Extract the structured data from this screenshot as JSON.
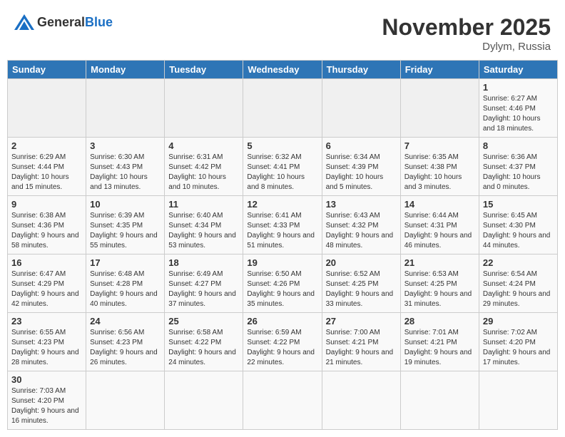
{
  "header": {
    "logo_general": "General",
    "logo_blue": "Blue",
    "month_year": "November 2025",
    "location": "Dylym, Russia"
  },
  "weekdays": [
    "Sunday",
    "Monday",
    "Tuesday",
    "Wednesday",
    "Thursday",
    "Friday",
    "Saturday"
  ],
  "weeks": [
    [
      {
        "day": "",
        "info": ""
      },
      {
        "day": "",
        "info": ""
      },
      {
        "day": "",
        "info": ""
      },
      {
        "day": "",
        "info": ""
      },
      {
        "day": "",
        "info": ""
      },
      {
        "day": "",
        "info": ""
      },
      {
        "day": "1",
        "info": "Sunrise: 6:27 AM\nSunset: 4:46 PM\nDaylight: 10 hours and 18 minutes."
      }
    ],
    [
      {
        "day": "2",
        "info": "Sunrise: 6:29 AM\nSunset: 4:44 PM\nDaylight: 10 hours and 15 minutes."
      },
      {
        "day": "3",
        "info": "Sunrise: 6:30 AM\nSunset: 4:43 PM\nDaylight: 10 hours and 13 minutes."
      },
      {
        "day": "4",
        "info": "Sunrise: 6:31 AM\nSunset: 4:42 PM\nDaylight: 10 hours and 10 minutes."
      },
      {
        "day": "5",
        "info": "Sunrise: 6:32 AM\nSunset: 4:41 PM\nDaylight: 10 hours and 8 minutes."
      },
      {
        "day": "6",
        "info": "Sunrise: 6:34 AM\nSunset: 4:39 PM\nDaylight: 10 hours and 5 minutes."
      },
      {
        "day": "7",
        "info": "Sunrise: 6:35 AM\nSunset: 4:38 PM\nDaylight: 10 hours and 3 minutes."
      },
      {
        "day": "8",
        "info": "Sunrise: 6:36 AM\nSunset: 4:37 PM\nDaylight: 10 hours and 0 minutes."
      }
    ],
    [
      {
        "day": "9",
        "info": "Sunrise: 6:38 AM\nSunset: 4:36 PM\nDaylight: 9 hours and 58 minutes."
      },
      {
        "day": "10",
        "info": "Sunrise: 6:39 AM\nSunset: 4:35 PM\nDaylight: 9 hours and 55 minutes."
      },
      {
        "day": "11",
        "info": "Sunrise: 6:40 AM\nSunset: 4:34 PM\nDaylight: 9 hours and 53 minutes."
      },
      {
        "day": "12",
        "info": "Sunrise: 6:41 AM\nSunset: 4:33 PM\nDaylight: 9 hours and 51 minutes."
      },
      {
        "day": "13",
        "info": "Sunrise: 6:43 AM\nSunset: 4:32 PM\nDaylight: 9 hours and 48 minutes."
      },
      {
        "day": "14",
        "info": "Sunrise: 6:44 AM\nSunset: 4:31 PM\nDaylight: 9 hours and 46 minutes."
      },
      {
        "day": "15",
        "info": "Sunrise: 6:45 AM\nSunset: 4:30 PM\nDaylight: 9 hours and 44 minutes."
      }
    ],
    [
      {
        "day": "16",
        "info": "Sunrise: 6:47 AM\nSunset: 4:29 PM\nDaylight: 9 hours and 42 minutes."
      },
      {
        "day": "17",
        "info": "Sunrise: 6:48 AM\nSunset: 4:28 PM\nDaylight: 9 hours and 40 minutes."
      },
      {
        "day": "18",
        "info": "Sunrise: 6:49 AM\nSunset: 4:27 PM\nDaylight: 9 hours and 37 minutes."
      },
      {
        "day": "19",
        "info": "Sunrise: 6:50 AM\nSunset: 4:26 PM\nDaylight: 9 hours and 35 minutes."
      },
      {
        "day": "20",
        "info": "Sunrise: 6:52 AM\nSunset: 4:25 PM\nDaylight: 9 hours and 33 minutes."
      },
      {
        "day": "21",
        "info": "Sunrise: 6:53 AM\nSunset: 4:25 PM\nDaylight: 9 hours and 31 minutes."
      },
      {
        "day": "22",
        "info": "Sunrise: 6:54 AM\nSunset: 4:24 PM\nDaylight: 9 hours and 29 minutes."
      }
    ],
    [
      {
        "day": "23",
        "info": "Sunrise: 6:55 AM\nSunset: 4:23 PM\nDaylight: 9 hours and 28 minutes."
      },
      {
        "day": "24",
        "info": "Sunrise: 6:56 AM\nSunset: 4:23 PM\nDaylight: 9 hours and 26 minutes."
      },
      {
        "day": "25",
        "info": "Sunrise: 6:58 AM\nSunset: 4:22 PM\nDaylight: 9 hours and 24 minutes."
      },
      {
        "day": "26",
        "info": "Sunrise: 6:59 AM\nSunset: 4:22 PM\nDaylight: 9 hours and 22 minutes."
      },
      {
        "day": "27",
        "info": "Sunrise: 7:00 AM\nSunset: 4:21 PM\nDaylight: 9 hours and 21 minutes."
      },
      {
        "day": "28",
        "info": "Sunrise: 7:01 AM\nSunset: 4:21 PM\nDaylight: 9 hours and 19 minutes."
      },
      {
        "day": "29",
        "info": "Sunrise: 7:02 AM\nSunset: 4:20 PM\nDaylight: 9 hours and 17 minutes."
      }
    ],
    [
      {
        "day": "30",
        "info": "Sunrise: 7:03 AM\nSunset: 4:20 PM\nDaylight: 9 hours and 16 minutes."
      },
      {
        "day": "",
        "info": ""
      },
      {
        "day": "",
        "info": ""
      },
      {
        "day": "",
        "info": ""
      },
      {
        "day": "",
        "info": ""
      },
      {
        "day": "",
        "info": ""
      },
      {
        "day": "",
        "info": ""
      }
    ]
  ]
}
